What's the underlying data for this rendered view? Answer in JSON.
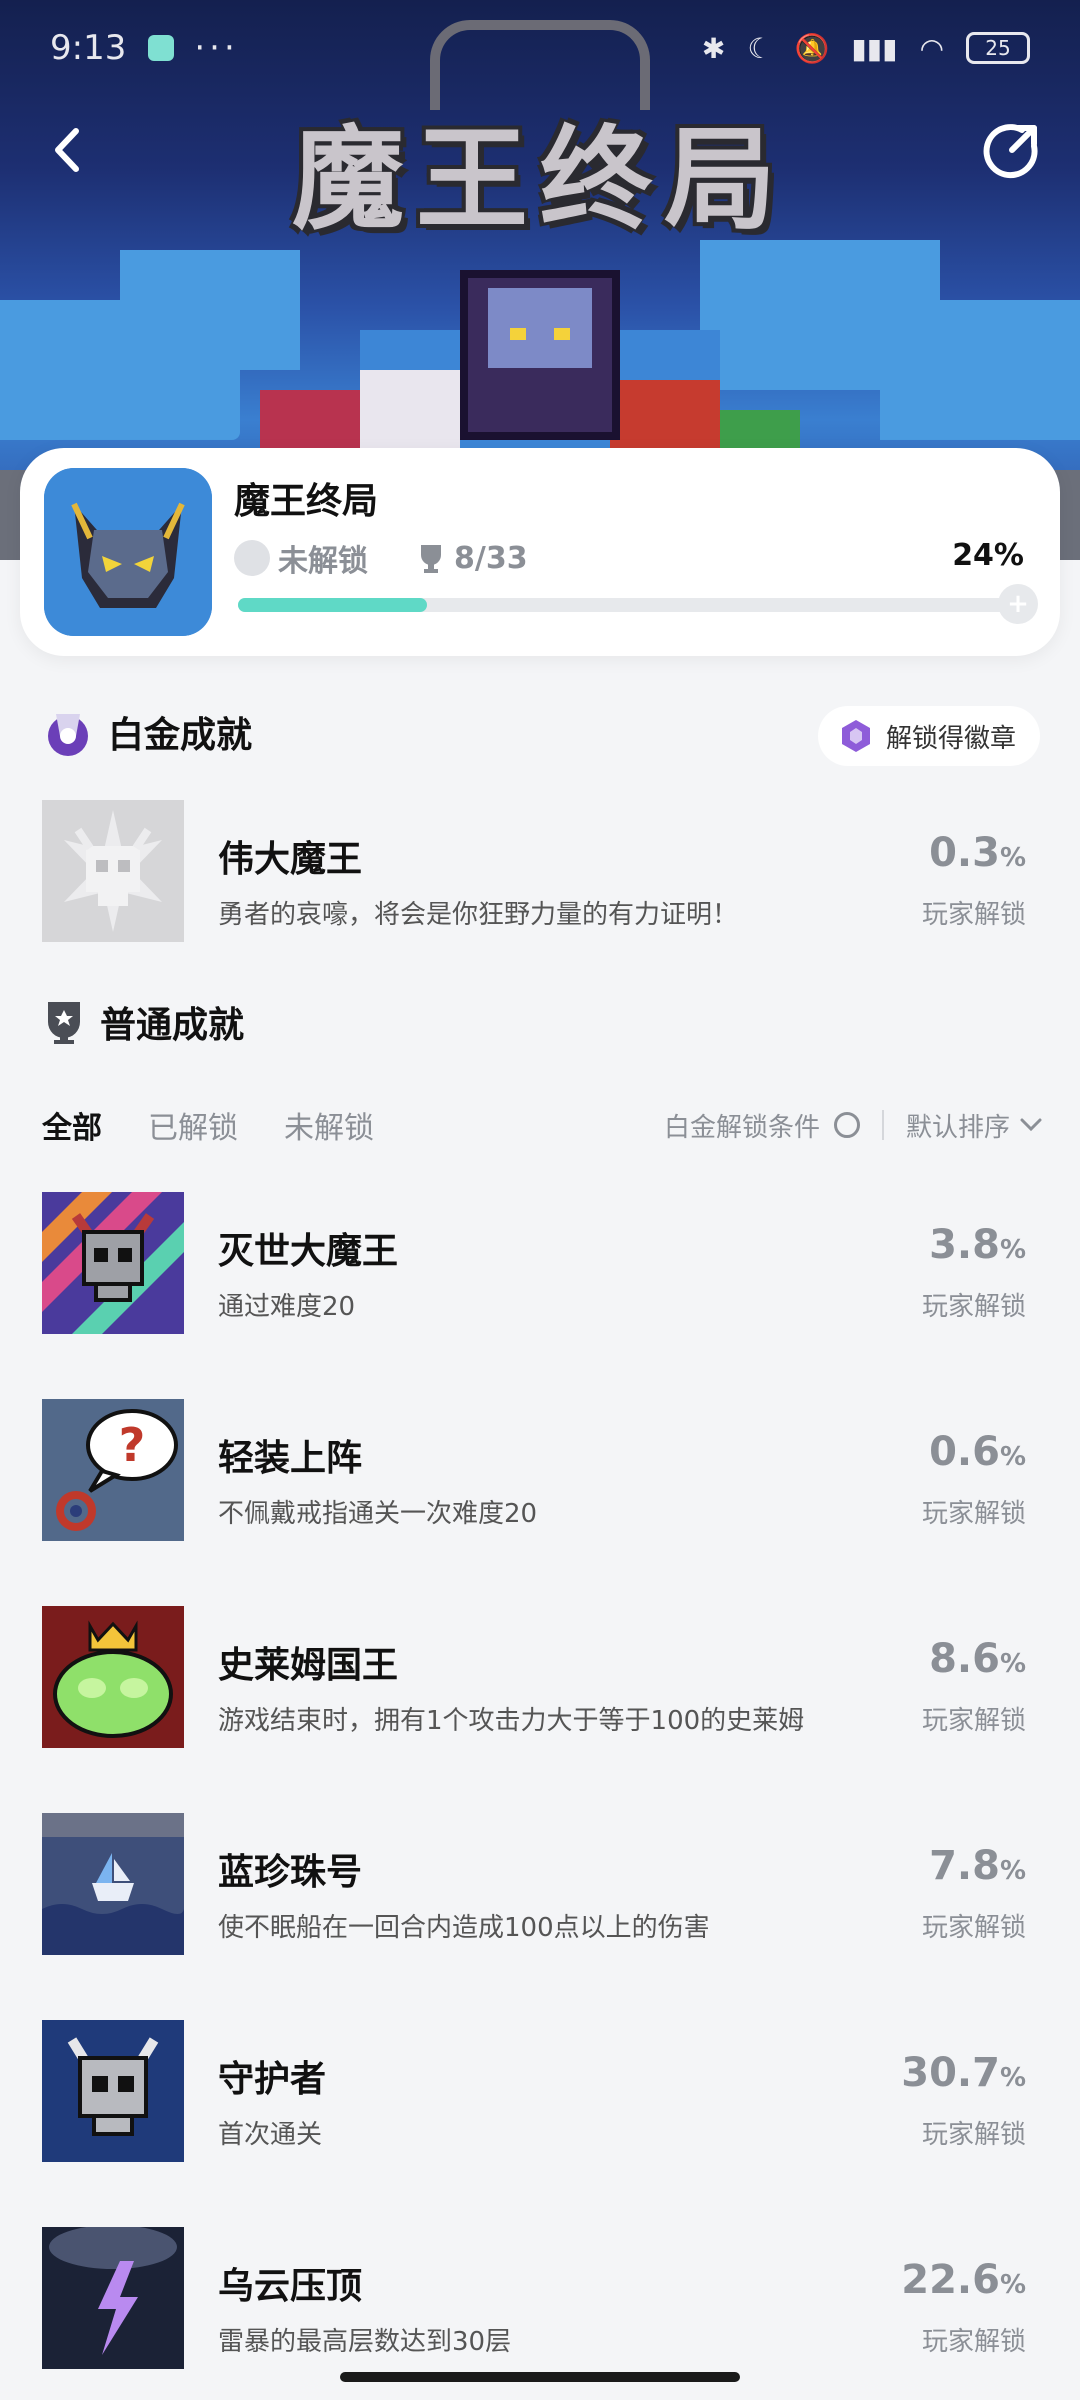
{
  "status_bar": {
    "time": "9:13",
    "dots": "···",
    "battery": "25"
  },
  "banner": {
    "logo_text": "魔王终局"
  },
  "game": {
    "title": "魔王终局",
    "platinum_status": "未解锁",
    "trophy_count": "8/33",
    "percent": "24%",
    "progress": 0.24,
    "progress_color": "#5fd9c6"
  },
  "platinum_section": {
    "title": "白金成就",
    "badge_button": "解锁得徽章",
    "achievement": {
      "name": "伟大魔王",
      "desc": "勇者的哀嚎，将会是你狂野力量的有力证明！",
      "pct": "0.3",
      "pct_unit": "%",
      "pct_label": "玩家解锁"
    }
  },
  "normal_section": {
    "title": "普通成就",
    "tabs": [
      "全部",
      "已解锁",
      "未解锁"
    ],
    "filter_label": "白金解锁条件",
    "sort_label": "默认排序"
  },
  "achievements": [
    {
      "name": "灭世大魔王",
      "desc": "通过难度20",
      "pct": "3.8",
      "pct_unit": "%",
      "pct_label": "玩家解锁"
    },
    {
      "name": "轻装上阵",
      "desc": "不佩戴戒指通关一次难度20",
      "pct": "0.6",
      "pct_unit": "%",
      "pct_label": "玩家解锁"
    },
    {
      "name": "史莱姆国王",
      "desc": "游戏结束时，拥有1个攻击力大于等于100的史莱姆",
      "pct": "8.6",
      "pct_unit": "%",
      "pct_label": "玩家解锁"
    },
    {
      "name": "蓝珍珠号",
      "desc": "使不眠船在一回合内造成100点以上的伤害",
      "pct": "7.8",
      "pct_unit": "%",
      "pct_label": "玩家解锁"
    },
    {
      "name": "守护者",
      "desc": "首次通关",
      "pct": "30.7",
      "pct_unit": "%",
      "pct_label": "玩家解锁"
    },
    {
      "name": "乌云压顶",
      "desc": "雷暴的最高层数达到30层",
      "pct": "22.6",
      "pct_unit": "%",
      "pct_label": "玩家解锁"
    }
  ]
}
